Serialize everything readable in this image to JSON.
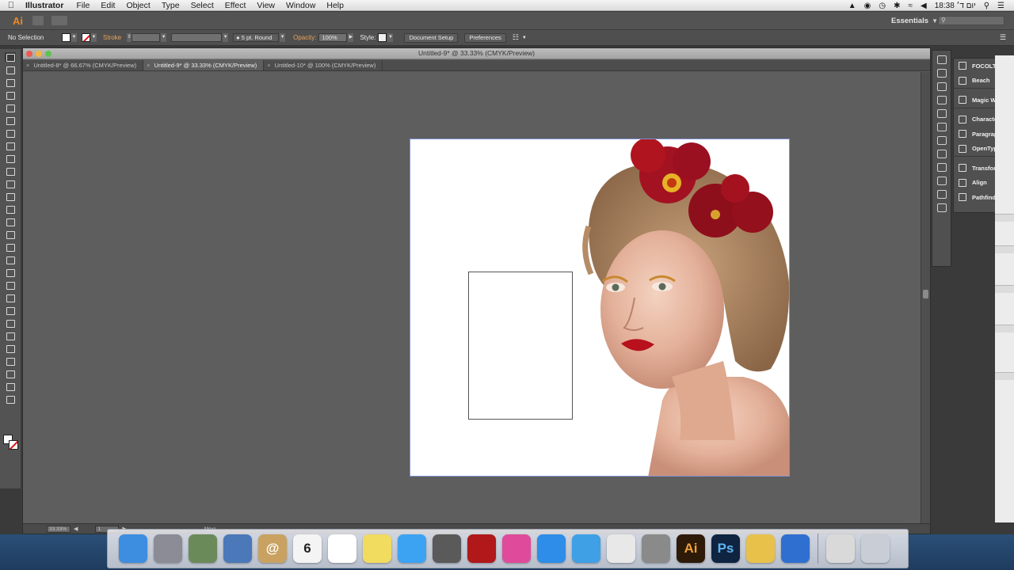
{
  "menubar": {
    "app_name": "Illustrator",
    "menus": [
      "File",
      "Edit",
      "Object",
      "Type",
      "Select",
      "Effect",
      "View",
      "Window",
      "Help"
    ],
    "time": "18:38",
    "day_label": "יום ד׳"
  },
  "appbar": {
    "logo": "Ai",
    "workspace": "Essentials"
  },
  "controlbar": {
    "selection": "No Selection",
    "stroke_label": "Stroke",
    "brush": "5 pt. Round",
    "opacity_label": "Opacity:",
    "opacity_value": "100%",
    "style_label": "Style:",
    "doc_setup_label": "Document Setup",
    "preferences_label": "Preferences"
  },
  "document": {
    "title": "Untitled-9* @ 33.33% (CMYK/Preview)",
    "tabs": [
      {
        "label": "Untitled-8* @ 66.67% (CMYK/Preview)",
        "active": false
      },
      {
        "label": "Untitled-9* @ 33.33% (CMYK/Preview)",
        "active": true
      },
      {
        "label": "Untitled-10* @ 100% (CMYK/Preview)",
        "active": false
      }
    ],
    "zoom": "33.33%",
    "page": "1"
  },
  "panels": {
    "items": [
      "FOCOLTONE",
      "Beach",
      "Magic Wand",
      "Character",
      "Paragraph",
      "OpenType",
      "Transform",
      "Align",
      "Pathfinder"
    ]
  },
  "dock": {
    "calendar_day": "6",
    "move_label": "Move",
    "apps": [
      {
        "name": "finder-icon",
        "color": "#3d8de0",
        "text": ""
      },
      {
        "name": "launchpad-icon",
        "color": "#8c8c96",
        "text": ""
      },
      {
        "name": "preview-icon",
        "color": "#6b8a5a",
        "text": ""
      },
      {
        "name": "mail-bird-icon",
        "color": "#4a78b8",
        "text": ""
      },
      {
        "name": "contacts-icon",
        "color": "#c9a262",
        "text": "@"
      },
      {
        "name": "calendar-icon",
        "color": "#f4f4f4",
        "text": "6"
      },
      {
        "name": "reminders-icon",
        "color": "#ffffff",
        "text": ""
      },
      {
        "name": "notes-icon",
        "color": "#f2dc60",
        "text": ""
      },
      {
        "name": "messages-icon",
        "color": "#3ca3f2",
        "text": ""
      },
      {
        "name": "facetime-icon",
        "color": "#5a5a5a",
        "text": ""
      },
      {
        "name": "photo-booth-icon",
        "color": "#b0181a",
        "text": ""
      },
      {
        "name": "itunes-icon",
        "color": "#e04a9a",
        "text": ""
      },
      {
        "name": "app-store-icon",
        "color": "#2d8de8",
        "text": ""
      },
      {
        "name": "safari-icon",
        "color": "#3fa0e6",
        "text": ""
      },
      {
        "name": "chrome-icon",
        "color": "#e8e8e8",
        "text": ""
      },
      {
        "name": "system-prefs-icon",
        "color": "#8a8a8a",
        "text": ""
      },
      {
        "name": "illustrator-icon",
        "color": "#2d1a08",
        "text": "Ai"
      },
      {
        "name": "photoshop-icon",
        "color": "#0e2440",
        "text": "Ps"
      },
      {
        "name": "archive-icon",
        "color": "#e8c14a",
        "text": ""
      },
      {
        "name": "quicktime-icon",
        "color": "#2f6fd0",
        "text": ""
      }
    ],
    "right_apps": [
      {
        "name": "downloads-stack-icon",
        "color": "#d9d9d9",
        "text": ""
      },
      {
        "name": "trash-icon",
        "color": "#c9ced6",
        "text": ""
      }
    ]
  }
}
